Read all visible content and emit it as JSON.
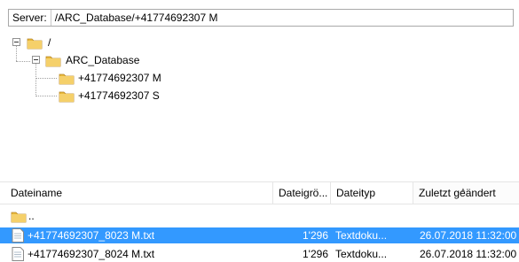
{
  "server": {
    "label": "Server:",
    "path": "/ARC_Database/+41774692307 M"
  },
  "tree": {
    "root": "/",
    "database": "ARC_Database",
    "children": [
      "+41774692307 M",
      "+41774692307 S"
    ]
  },
  "file_list": {
    "columns": [
      "Dateiname",
      "Dateigrö...",
      "Dateityp",
      "Zuletzt geändert"
    ],
    "parent_entry": "..",
    "rows": [
      {
        "name": "+41774692307_8023 M.txt",
        "size": "1'296",
        "type": "Textdoku...",
        "modified": "26.07.2018 11:32:00"
      },
      {
        "name": "+41774692307_8024 M.txt",
        "size": "1'296",
        "type": "Textdoku...",
        "modified": "26.07.2018 11:32:00"
      }
    ]
  },
  "colors": {
    "selection": "#3399ff",
    "folder": "#e8b93a",
    "border": "#a9a9a9"
  }
}
